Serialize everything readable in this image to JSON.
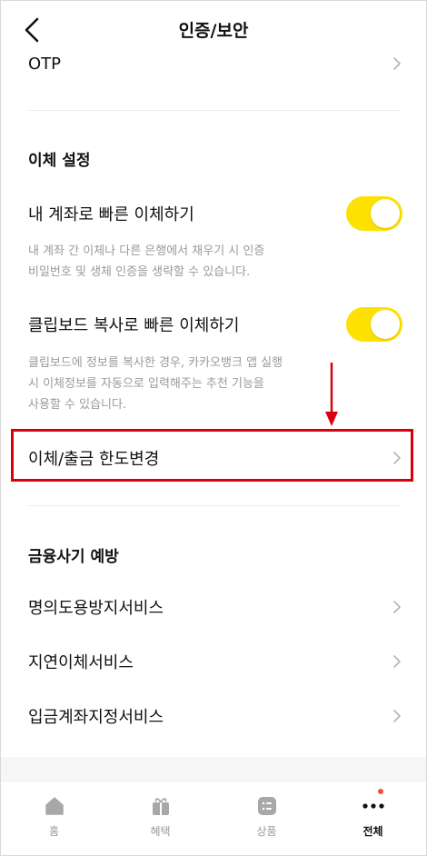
{
  "header": {
    "title": "인증/보안",
    "back_icon": "chevron-left-icon"
  },
  "otp": {
    "label": "OTP"
  },
  "transfer_settings": {
    "section_title": "이체 설정",
    "quick_own_account": {
      "label": "내 계좌로 빠른 이체하기",
      "enabled": true,
      "description_line1": "내 계좌 간 이체나 다른 은행에서 채우기 시 인증",
      "description_line2": "비밀번호 및 생체 인증을 생략할 수 있습니다."
    },
    "clipboard_quick": {
      "label": "클립보드 복사로 빠른 이체하기",
      "enabled": true,
      "description_line1": "클립보드에 정보를 복사한 경우, 카카오뱅크 앱 실행",
      "description_line2": "시 이체정보를 자동으로 입력해주는 추천 기능을",
      "description_line3": "사용할 수 있습니다."
    },
    "limit_change": {
      "label": "이체/출금 한도변경"
    }
  },
  "fraud_prevention": {
    "section_title": "금융사기 예방",
    "items": [
      {
        "label": "명의도용방지서비스"
      },
      {
        "label": "지연이체서비스"
      },
      {
        "label": "입금계좌지정서비스"
      }
    ]
  },
  "bottom_nav": {
    "items": [
      {
        "label": "홈",
        "icon": "home-icon"
      },
      {
        "label": "혜택",
        "icon": "gift-icon"
      },
      {
        "label": "상품",
        "icon": "products-icon"
      },
      {
        "label": "전체",
        "icon": "more-dots-icon",
        "active": true
      }
    ]
  },
  "colors": {
    "toggle_on": "#fde100",
    "highlight": "#d7000f",
    "notification_dot": "#f04e3e"
  }
}
